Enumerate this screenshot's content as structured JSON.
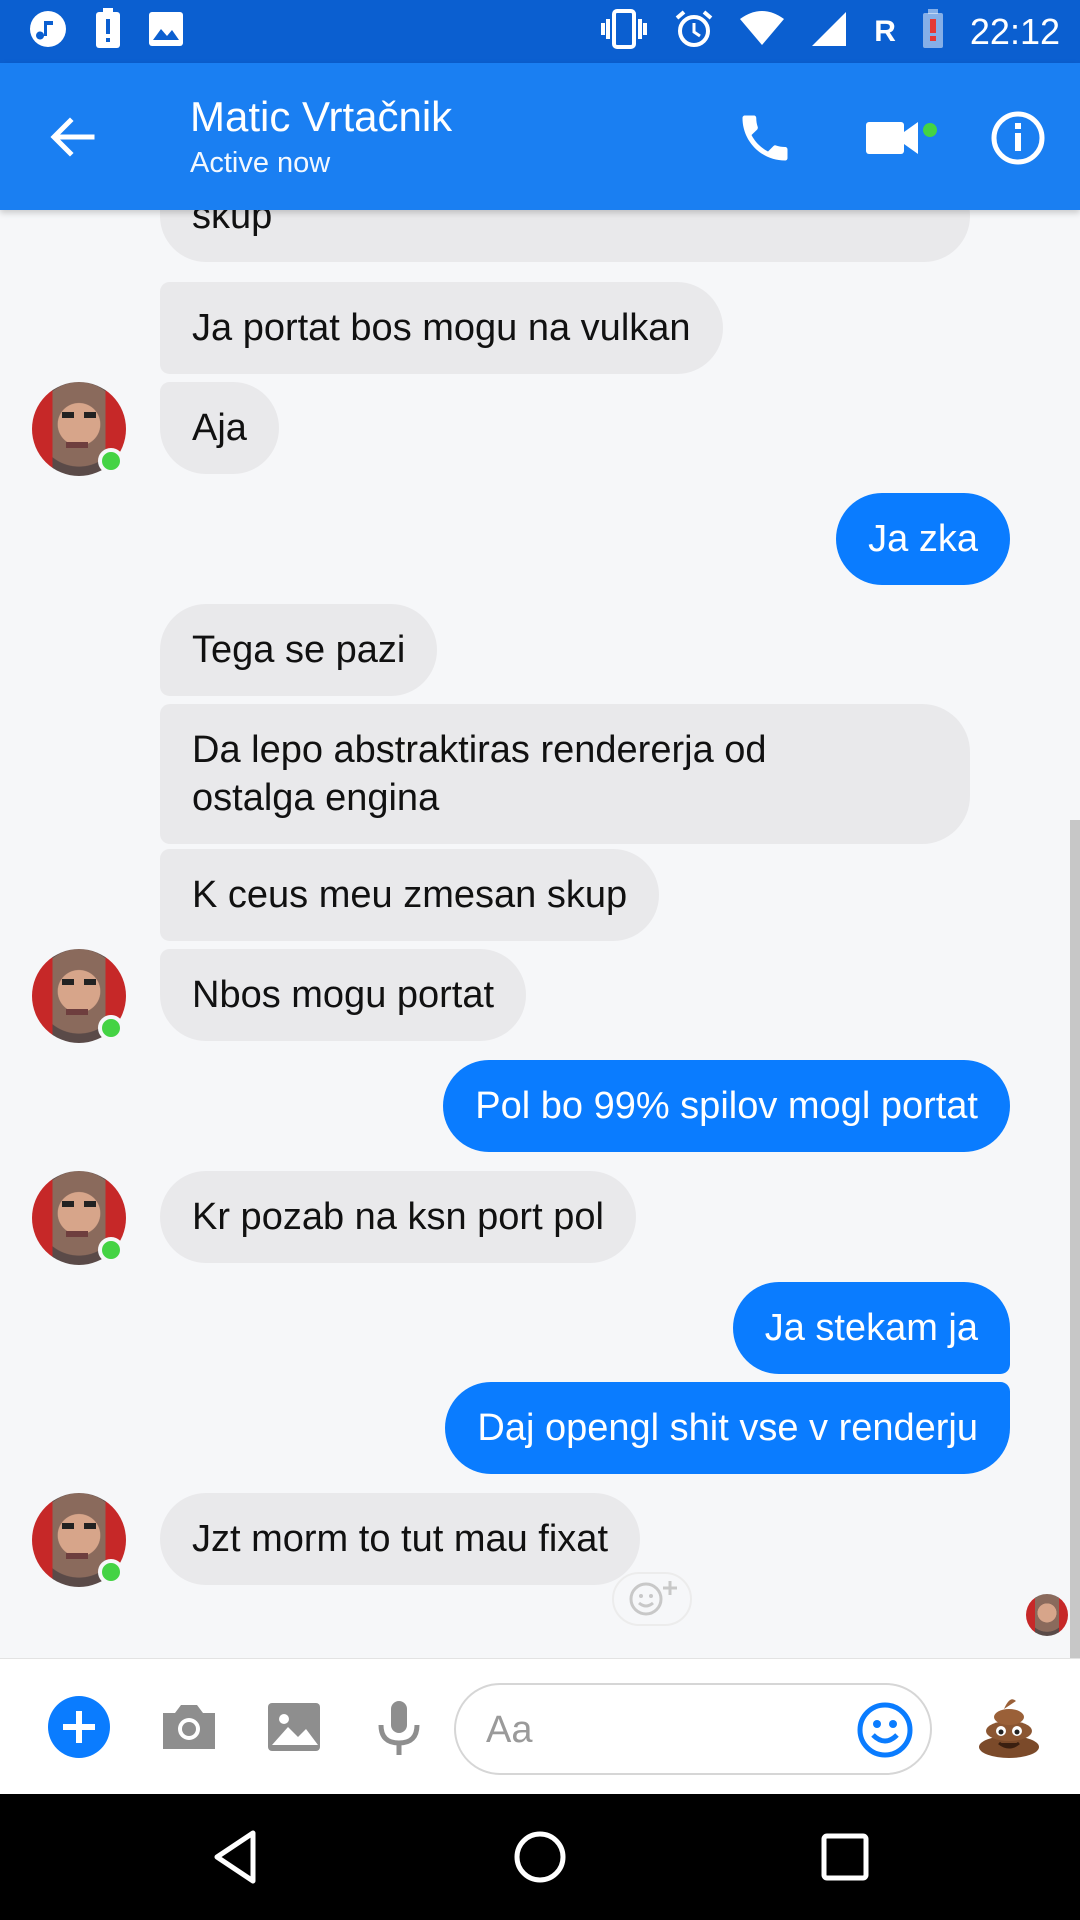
{
  "status_bar": {
    "time": "22:12",
    "roaming": "R",
    "left_icons": [
      "music-icon",
      "battery-alert-icon",
      "image-icon"
    ],
    "right_icons": [
      "vibrate-icon",
      "alarm-icon",
      "wifi-icon",
      "signal-icon",
      "battery-low-icon"
    ]
  },
  "header": {
    "contact_name": "Matic Vrtačnik",
    "contact_status": "Active now",
    "icons": [
      "back-arrow-icon",
      "phone-icon",
      "video-camera-icon",
      "info-icon"
    ]
  },
  "messages": [
    {
      "from": "them",
      "text": "skup"
    },
    {
      "from": "them",
      "text": "Ja portat bos mogu na vulkan"
    },
    {
      "from": "them",
      "text": "Aja"
    },
    {
      "from": "me",
      "text": "Ja zka"
    },
    {
      "from": "them",
      "text": "Tega se pazi"
    },
    {
      "from": "them",
      "text": "Da lepo abstraktiras rendererja od"
    },
    {
      "from": "them",
      "text": "ostalga engina"
    },
    {
      "from": "them",
      "text": "K ceus meu zmesan skup"
    },
    {
      "from": "them",
      "text": "Nbos mogu portat"
    },
    {
      "from": "me",
      "text": "Pol bo 99% spilov mogl portat"
    },
    {
      "from": "them",
      "text": "Kr pozab na ksn port pol"
    },
    {
      "from": "me",
      "text": "Ja stekam ja"
    },
    {
      "from": "me",
      "text": "Daj opengl shit vse v renderju"
    },
    {
      "from": "them",
      "text": "Jzt morm to tut mau fixat"
    }
  ],
  "composer": {
    "placeholder": "Aa",
    "icons": [
      "plus-icon",
      "camera-icon",
      "gallery-icon",
      "microphone-icon",
      "emoji-icon",
      "poop-emoji-icon"
    ]
  },
  "colors": {
    "status_bar": "#0b5fd0",
    "header": "#1a7ff2",
    "outgoing_bubble": "#0a7cff",
    "incoming_bubble": "#e9e9eb",
    "online": "#44d344"
  }
}
